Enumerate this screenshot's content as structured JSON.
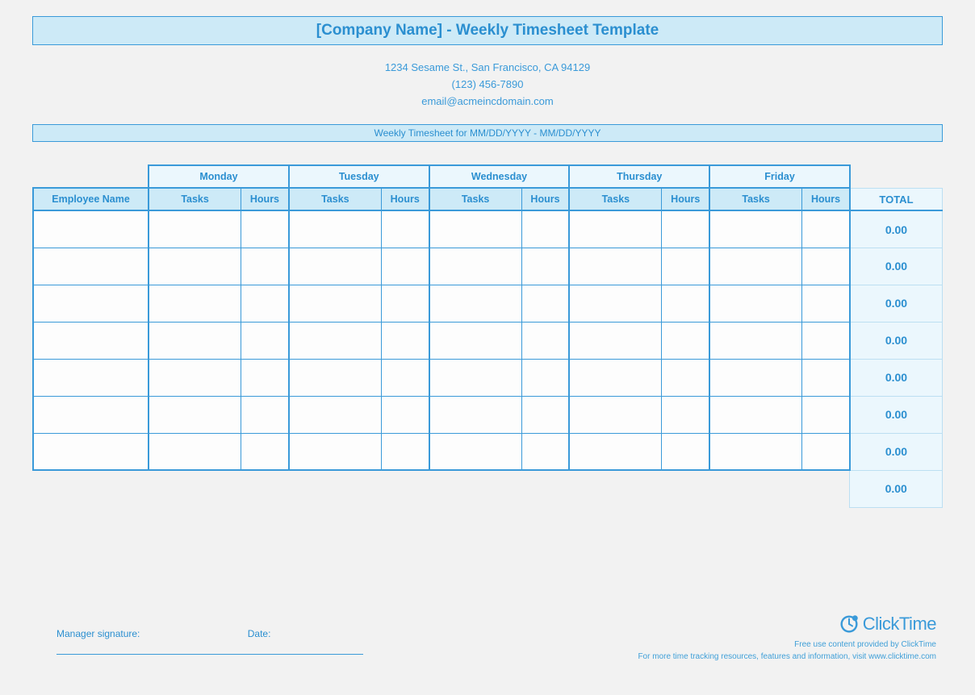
{
  "header": {
    "title": "[Company Name] - Weekly Timesheet Template",
    "address": "1234 Sesame St.,  San Francisco, CA 94129",
    "phone": "(123) 456-7890",
    "email": "email@acmeincdomain.com",
    "range": "Weekly Timesheet for MM/DD/YYYY - MM/DD/YYYY"
  },
  "columns": {
    "employee": "Employee Name",
    "tasks": "Tasks",
    "hours": "Hours",
    "total": "TOTAL"
  },
  "days": [
    "Monday",
    "Tuesday",
    "Wednesday",
    "Thursday",
    "Friday"
  ],
  "rows": [
    {
      "total": "0.00"
    },
    {
      "total": "0.00"
    },
    {
      "total": "0.00"
    },
    {
      "total": "0.00"
    },
    {
      "total": "0.00"
    },
    {
      "total": "0.00"
    },
    {
      "total": "0.00"
    }
  ],
  "grand_total": "0.00",
  "signature": {
    "label": "Manager signature:",
    "date_label": "Date:"
  },
  "brand": {
    "name": "ClickTime",
    "line1": "Free use content provided by ClickTime",
    "line2": "For more time tracking resources, features and information, visit www.clicktime.com"
  }
}
